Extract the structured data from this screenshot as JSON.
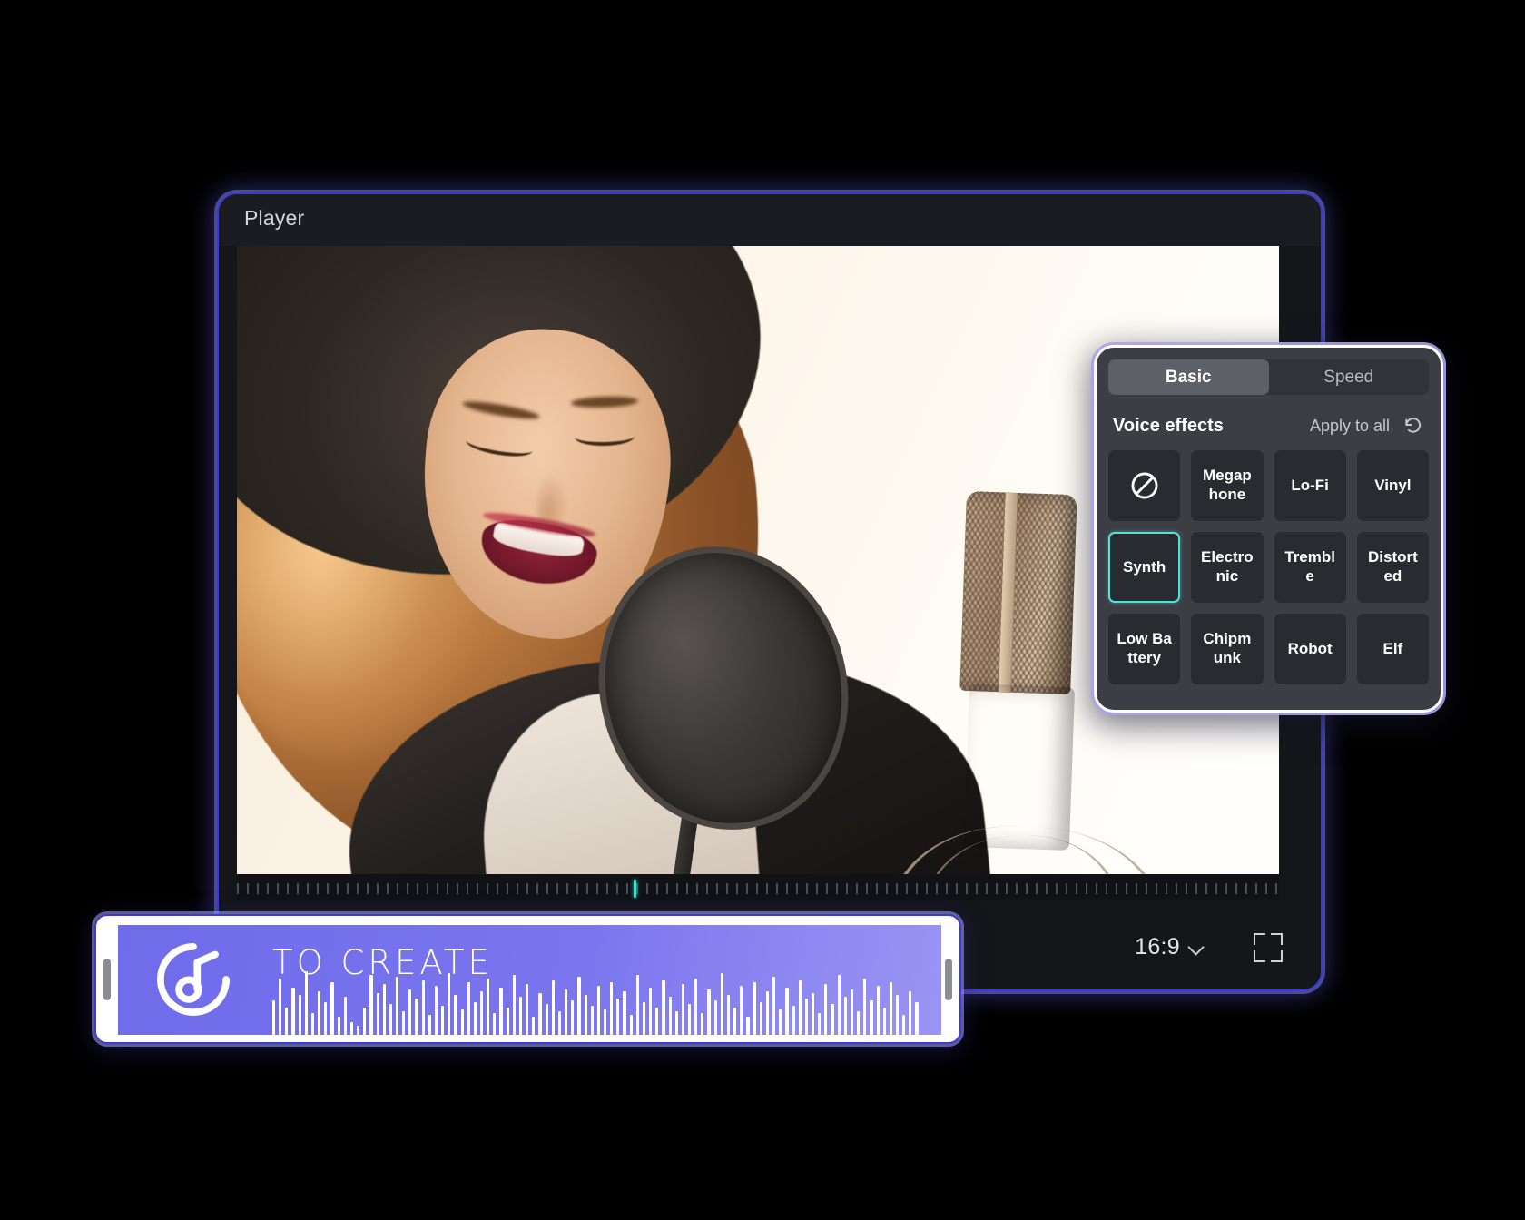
{
  "player": {
    "title": "Player",
    "aspect_ratio": "16:9",
    "aspect_chevron_icon": "chevron-down-icon",
    "fullscreen_icon": "fullscreen-icon",
    "playhead_color": "#3fe0cf",
    "border_color": "#3d3bd6"
  },
  "effects_panel": {
    "tabs": [
      {
        "label": "Basic",
        "active": true
      },
      {
        "label": "Speed",
        "active": false
      }
    ],
    "section_title": "Voice effects",
    "apply_to_all_label": "Apply to all",
    "reset_icon": "reset-arrow-icon",
    "selected_effect": "Synth",
    "selection_color": "#4fe3da",
    "effects": [
      {
        "label": "",
        "icon": "prohibition-none-icon",
        "selected": false
      },
      {
        "label": "Megaphone",
        "icon": null,
        "selected": false
      },
      {
        "label": "Lo-Fi",
        "icon": null,
        "selected": false
      },
      {
        "label": "Vinyl",
        "icon": null,
        "selected": false
      },
      {
        "label": "Synth",
        "icon": null,
        "selected": true
      },
      {
        "label": "Electronic",
        "icon": null,
        "selected": false
      },
      {
        "label": "Tremble",
        "icon": null,
        "selected": false
      },
      {
        "label": "Distorted",
        "icon": null,
        "selected": false
      },
      {
        "label": "Low Battery",
        "icon": null,
        "selected": false
      },
      {
        "label": "Chipmunk",
        "icon": null,
        "selected": false
      },
      {
        "label": "Robot",
        "icon": null,
        "selected": false
      },
      {
        "label": "Elf",
        "icon": null,
        "selected": false
      }
    ]
  },
  "audio_clip": {
    "title": "TO CREATE",
    "logo_icon": "music-note-circle-icon",
    "clip_color": "#7b75ee",
    "waveform_heights": [
      38,
      62,
      30,
      52,
      44,
      70,
      24,
      48,
      36,
      58,
      20,
      42,
      14,
      10,
      30,
      66,
      46,
      56,
      34,
      64,
      26,
      50,
      40,
      60,
      22,
      54,
      32,
      68,
      44,
      28,
      58,
      36,
      48,
      62,
      24,
      52,
      30,
      66,
      42,
      56,
      20,
      46,
      34,
      60,
      26,
      50,
      38,
      64,
      44,
      32,
      54,
      28,
      58,
      40,
      48,
      22,
      66,
      36,
      52,
      30,
      60,
      42,
      26,
      56,
      34,
      62,
      24,
      50,
      38,
      68,
      44,
      30,
      54,
      20,
      58,
      36,
      48,
      64,
      28,
      52,
      32,
      60,
      40,
      46,
      24,
      56,
      34,
      66,
      42,
      50,
      26,
      62,
      38,
      54,
      30,
      58,
      44,
      22,
      48,
      36
    ]
  }
}
